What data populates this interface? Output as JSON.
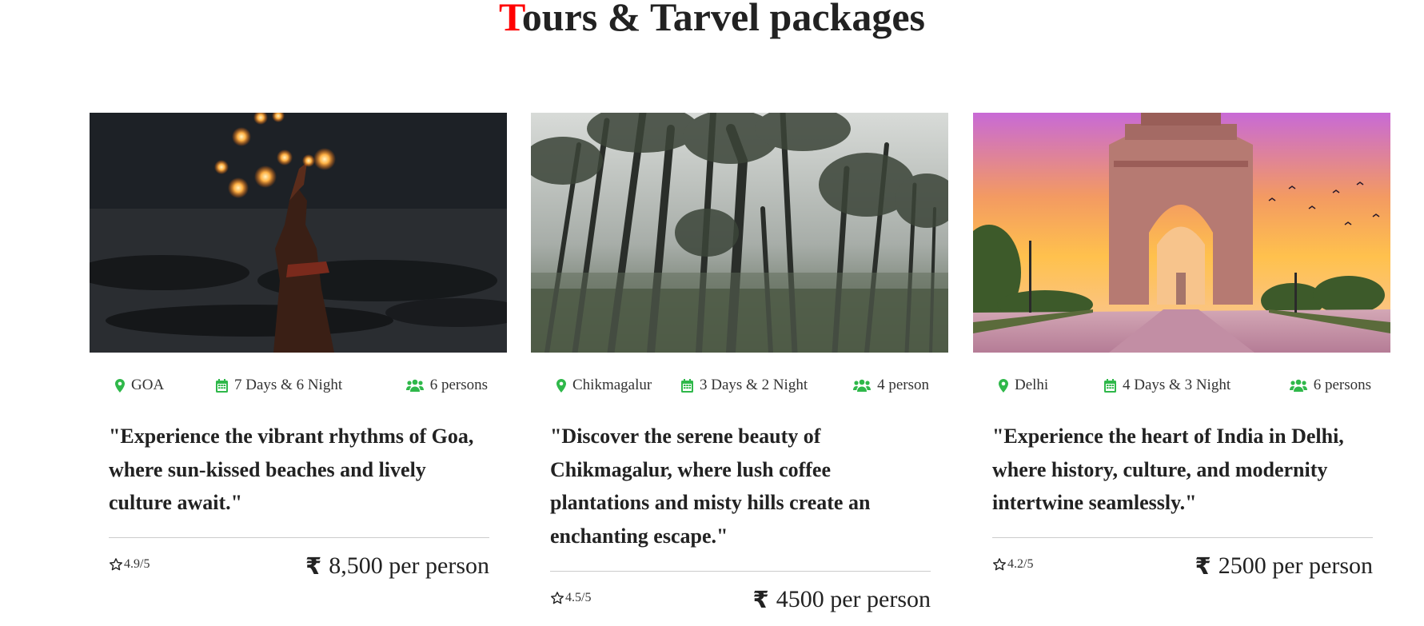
{
  "header": {
    "title_first_letter": "T",
    "title_rest": "ours & Tarvel packages"
  },
  "colors": {
    "accent_red": "#ff0000",
    "icon_green": "#2fb84a",
    "text_dark": "#222222"
  },
  "packages": [
    {
      "image_alt": "Fire dancer at night",
      "location": "GOA",
      "duration": "7 Days & 6 Night",
      "people": "6 persons",
      "description": "\"Experience the vibrant rhythms of Goa, where sun-kissed beaches and lively culture await.\"",
      "rating": "4.9/5",
      "currency_symbol": "₹",
      "price": "8,500 per person"
    },
    {
      "image_alt": "Misty forest",
      "location": "Chikmagalur",
      "duration": "3 Days & 2 Night",
      "people": "4 person",
      "description": "\"Discover the serene beauty of Chikmagalur, where lush coffee plantations and misty hills create an enchanting escape.\"",
      "rating": "4.5/5",
      "currency_symbol": "₹",
      "price": "4500 per person"
    },
    {
      "image_alt": "India Gate at sunset",
      "location": "Delhi",
      "duration": "4 Days & 3 Night",
      "people": "6 persons",
      "description": "\"Experience the heart of India in Delhi, where history, culture, and modernity intertwine seamlessly.\"",
      "rating": "4.2/5",
      "currency_symbol": "₹",
      "price": "2500 per person"
    }
  ]
}
